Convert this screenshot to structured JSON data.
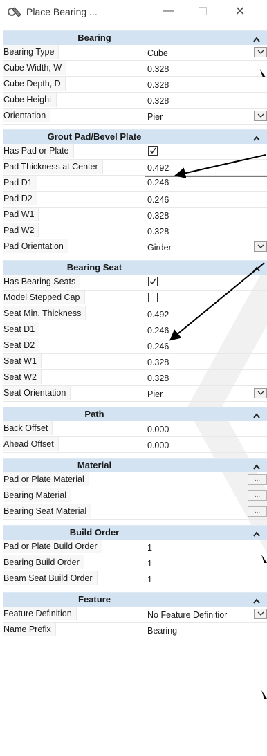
{
  "window": {
    "title": "Place Bearing ..."
  },
  "sections": [
    {
      "title": "Bearing",
      "rows": [
        {
          "label": "Bearing Type",
          "value": "Cube",
          "kind": "dropdown"
        },
        {
          "label": "Cube Width, W",
          "value": "0.328",
          "kind": "text"
        },
        {
          "label": "Cube Depth, D",
          "value": "0.328",
          "kind": "text"
        },
        {
          "label": "Cube Height",
          "value": "0.328",
          "kind": "text"
        },
        {
          "label": "Orientation",
          "value": "Pier",
          "kind": "dropdown"
        }
      ]
    },
    {
      "title": "Grout Pad/Bevel Plate",
      "rows": [
        {
          "label": "Has Pad or Plate",
          "checked": true,
          "kind": "checkbox"
        },
        {
          "label": "Pad Thickness at Center",
          "value": "0.492",
          "kind": "text"
        },
        {
          "label": "Pad D1",
          "value": "0.246",
          "kind": "input"
        },
        {
          "label": "Pad  D2",
          "value": "0.246",
          "kind": "text"
        },
        {
          "label": "Pad W1",
          "value": "0.328",
          "kind": "text"
        },
        {
          "label": "Pad W2",
          "value": "0.328",
          "kind": "text"
        },
        {
          "label": "Pad Orientation",
          "value": "Girder",
          "kind": "dropdown"
        }
      ]
    },
    {
      "title": "Bearing Seat",
      "rows": [
        {
          "label": "Has Bearing Seats",
          "checked": true,
          "kind": "checkbox"
        },
        {
          "label": "Model Stepped Cap",
          "checked": false,
          "kind": "checkbox"
        },
        {
          "label": "Seat Min. Thickness",
          "value": "0.492",
          "kind": "text"
        },
        {
          "label": "Seat D1",
          "value": "0.246",
          "kind": "text"
        },
        {
          "label": "Seat D2",
          "value": "0.246",
          "kind": "text"
        },
        {
          "label": "Seat W1",
          "value": "0.328",
          "kind": "text"
        },
        {
          "label": "Seat W2",
          "value": "0.328",
          "kind": "text"
        },
        {
          "label": "Seat Orientation",
          "value": "Pier",
          "kind": "dropdown"
        }
      ]
    },
    {
      "title": "Path",
      "rows": [
        {
          "label": "Back Offset",
          "value": "0.000",
          "kind": "text"
        },
        {
          "label": "Ahead Offset",
          "value": "0.000",
          "kind": "text"
        }
      ]
    },
    {
      "title": "Material",
      "rows": [
        {
          "label": "Pad or Plate Material",
          "value": "...",
          "kind": "ellipsis"
        },
        {
          "label": "Bearing Material",
          "value": "...",
          "kind": "ellipsis"
        },
        {
          "label": "Bearing Seat Material",
          "value": "...",
          "kind": "ellipsis"
        }
      ]
    },
    {
      "title": "Build Order",
      "rows": [
        {
          "label": "Pad or Plate Build Order",
          "value": "1",
          "kind": "text"
        },
        {
          "label": "Bearing Build Order",
          "value": "1",
          "kind": "text"
        },
        {
          "label": "Beam Seat Build Order",
          "value": "1",
          "kind": "text"
        }
      ]
    },
    {
      "title": "Feature",
      "rows": [
        {
          "label": "Feature Definition",
          "value": "No Feature Definitior",
          "kind": "dropdown"
        },
        {
          "label": "Name Prefix",
          "value": "Bearing",
          "kind": "text"
        }
      ]
    }
  ]
}
